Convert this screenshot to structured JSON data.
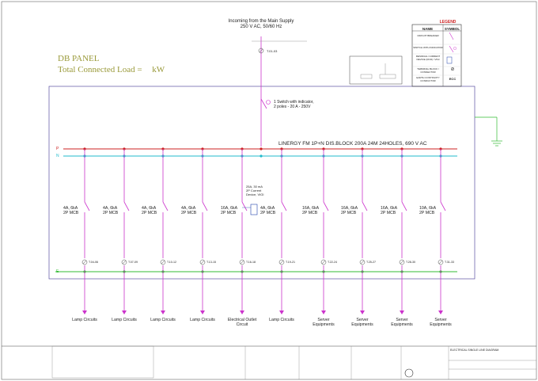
{
  "db_panel": {
    "title": "DB PANEL",
    "load_label": "Total Connected Load =",
    "load_unit": "kW"
  },
  "incoming": {
    "line1": "Incoming from the Main Supply",
    "line2": "250 V AC, 50/60 Hz"
  },
  "main_switch": {
    "line1": "1 Switch with indicator,",
    "line2": "2 poles - 20 A - 250V"
  },
  "busbar_block": {
    "label": "LINERGY FM 1P+N DIS.BLOCK 200A 24M 24HOLES, 690 V AC"
  },
  "rcd": {
    "line1": "25A, 30 mA",
    "line2": "2P Current",
    "line3": "Device, VIGI"
  },
  "bus_labels": {
    "phase": "P",
    "neutral": "N",
    "earth": "E"
  },
  "legend": {
    "title": "LEGEND",
    "col_name": "NAME",
    "col_symbol": "SYMBOL",
    "rows": [
      {
        "name": "CIRCUIT BREAKER",
        "symbol": ""
      },
      {
        "name": "SWITCH WITH INDICATOR",
        "symbol": ""
      },
      {
        "name": "RESIDUAL CURRENT DEVICE (RCD) / VIGI",
        "symbol": ""
      },
      {
        "name": "TERMINAL BLOCK / CONNECTOR",
        "symbol": "⊘"
      },
      {
        "name": "EARTH CONTINUITY CONDUCTOR",
        "symbol": "ECC"
      }
    ]
  },
  "circuits": [
    {
      "mcb_rating": "4A, 6kA",
      "mcb_type": "2P MCB",
      "terminal": "T.04-06",
      "name": "Lamp Circuits"
    },
    {
      "mcb_rating": "4A, 6kA",
      "mcb_type": "2P MCB",
      "terminal": "T.07-09",
      "name": "Lamp Circuits"
    },
    {
      "mcb_rating": "4A, 6kA",
      "mcb_type": "2P MCB",
      "terminal": "T.10-12",
      "name": "Lamp Circuits"
    },
    {
      "mcb_rating": "4A, 6kA",
      "mcb_type": "2P MCB",
      "terminal": "T.13-15",
      "name": "Lamp Circuits"
    },
    {
      "mcb_rating": "16A, 6kA",
      "mcb_type": "2P MCB",
      "terminal": "T.16-18",
      "name": "Electrical Outlet Circuit"
    },
    {
      "mcb_rating": "4A, 6kA",
      "mcb_type": "2P MCB",
      "terminal": "T.19-21",
      "name": "Lamp Circuits"
    },
    {
      "mcb_rating": "16A, 6kA",
      "mcb_type": "2P MCB",
      "terminal": "T.22-24",
      "name": "Server Equipments"
    },
    {
      "mcb_rating": "16A, 6kA",
      "mcb_type": "2P MCB",
      "terminal": "T.25-27",
      "name": "Server Equipments"
    },
    {
      "mcb_rating": "16A, 6kA",
      "mcb_type": "2P MCB",
      "terminal": "T.28-30",
      "name": "Server Equipments"
    },
    {
      "mcb_rating": "10A, 6kA",
      "mcb_type": "2P MCB",
      "terminal": "T.31-33",
      "name": "Server Equipments"
    }
  ],
  "incoming_terminal": "T.01-03",
  "title_block": {
    "drawing_title": "ELECTRICAL SINGLE LINE DIAGRAM"
  },
  "colors": {
    "phase_bus": "#cc2222",
    "neutral_bus": "#22bbcc",
    "earth_bus": "#33bb33",
    "feeder": "#cc33cc",
    "panel_border": "#5a4fa0"
  }
}
